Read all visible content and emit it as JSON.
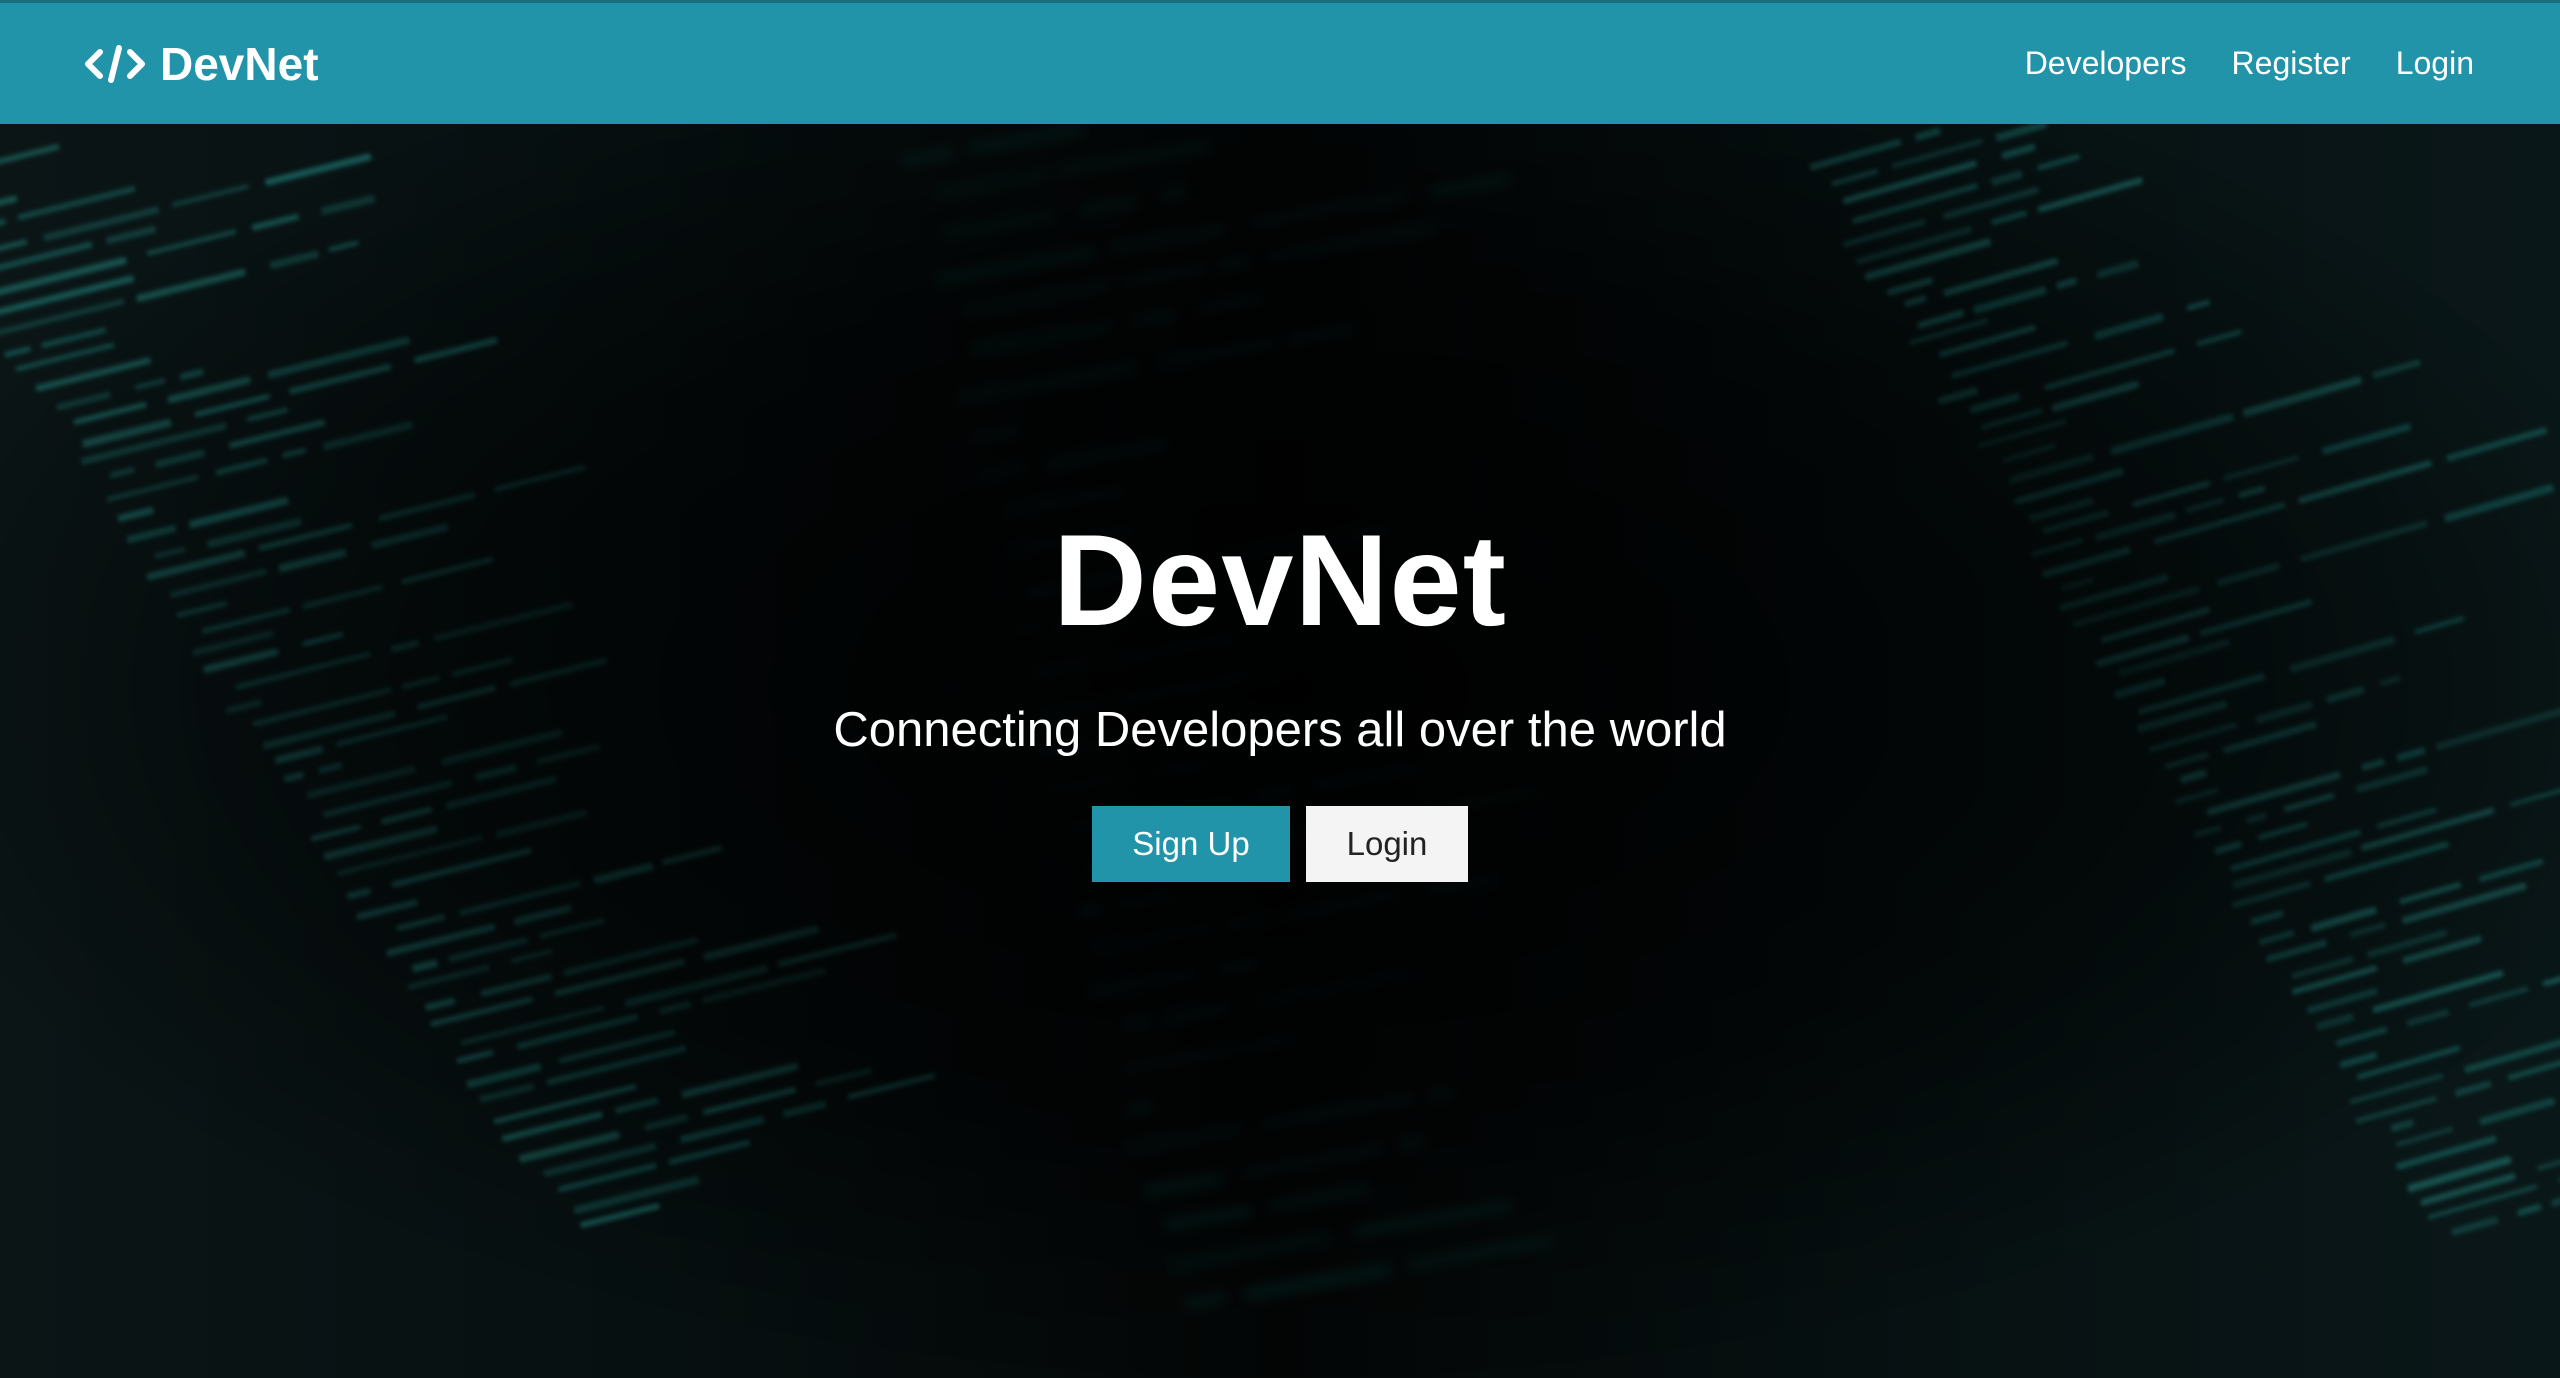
{
  "navbar": {
    "brand": "DevNet",
    "brand_icon": "code-icon",
    "links": [
      {
        "label": "Developers"
      },
      {
        "label": "Register"
      },
      {
        "label": "Login"
      }
    ]
  },
  "hero": {
    "title": "DevNet",
    "subtitle": "Connecting Developers all over the world",
    "buttons": {
      "primary": "Sign Up",
      "secondary": "Login"
    }
  },
  "colors": {
    "accent": "#2294a9",
    "background": "#050708",
    "code_glow": "#1f8f86"
  }
}
